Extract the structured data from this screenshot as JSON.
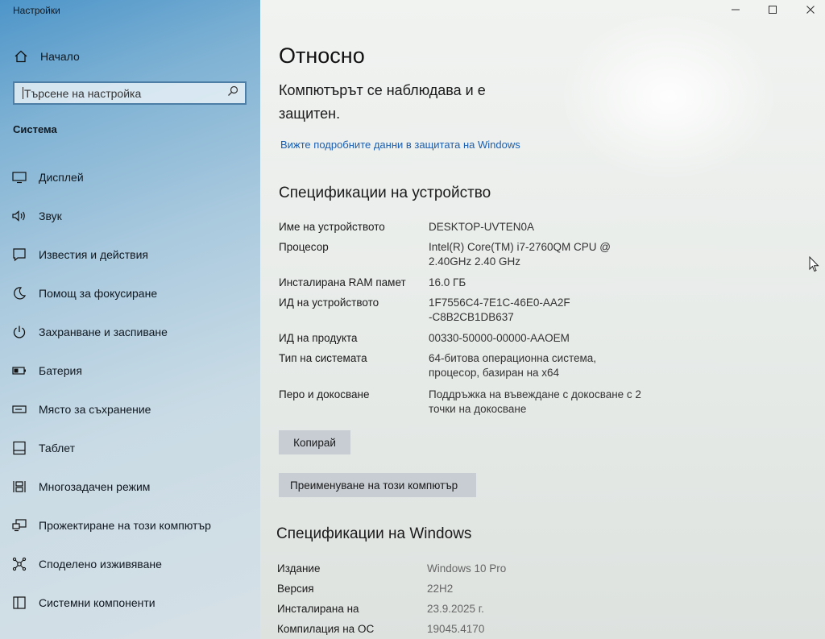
{
  "window": {
    "title": "Настройки",
    "controls": {
      "minimize": "—",
      "maximize": "☐",
      "close": "✕"
    }
  },
  "sidebar": {
    "home_label": "Начало",
    "search_placeholder": "Търсене на настройка",
    "section_title": "Система",
    "items": [
      {
        "label": "Дисплей",
        "icon": "display-icon"
      },
      {
        "label": "Звук",
        "icon": "sound-icon"
      },
      {
        "label": "Известия и действия",
        "icon": "notifications-icon"
      },
      {
        "label": "Помощ за фокусиране",
        "icon": "moon-icon"
      },
      {
        "label": "Захранване и заспиване",
        "icon": "power-icon"
      },
      {
        "label": "Батерия",
        "icon": "battery-icon"
      },
      {
        "label": "Място за съхранение",
        "icon": "storage-icon"
      },
      {
        "label": "Таблет",
        "icon": "tablet-icon"
      },
      {
        "label": "Многозадачен режим",
        "icon": "multitasking-icon"
      },
      {
        "label": "Прожектиране на този компютър",
        "icon": "projecting-icon"
      },
      {
        "label": "Споделено изживяване",
        "icon": "shared-icon"
      },
      {
        "label": "Системни компоненти",
        "icon": "components-icon"
      }
    ]
  },
  "main": {
    "title": "Относно",
    "protection_status": "Компютърът се наблюдава и е защитен.",
    "security_link": "Вижте подробните данни в защитата на Windows",
    "device_specs": {
      "heading": "Спецификации на устройство",
      "rows": [
        {
          "label": "Име на устройството",
          "value": "DESKTOP-UVTEN0A"
        },
        {
          "label": "Процесор",
          "value": "Intel(R) Core(TM) i7-2760QM CPU @ 2.40GHz   2.40 GHz"
        },
        {
          "label": "Инсталирана RAM памет",
          "value": "16.0 ГБ"
        },
        {
          "label": "ИД на устройството",
          "value": "1F7556C4-7E1C-46E0-AA2F-C8B2CB1DB637"
        },
        {
          "label": "ИД на продукта",
          "value": "00330-50000-00000-AAOEM"
        },
        {
          "label": "Тип на системата",
          "value": "64-битова операционна система, процесор, базиран на x64"
        },
        {
          "label": "Перо и докосване",
          "value": "Поддръжка на въвеждане с докосване с 2 точки на докосване"
        }
      ],
      "copy_button": "Копирай",
      "rename_button": "Преименуване на този компютър"
    },
    "windows_specs": {
      "heading": "Спецификации на Windows",
      "rows": [
        {
          "label": "Издание",
          "value": "Windows 10 Pro"
        },
        {
          "label": "Версия",
          "value": "22H2"
        },
        {
          "label": "Инсталирана на",
          "value": "23.9.2025 г."
        },
        {
          "label": "Компилация на ОС",
          "value": "19045.4170"
        }
      ]
    }
  },
  "colors": {
    "accent": "#1c5fb0",
    "button_bg": "#c7cdd3",
    "sidebar_top": "#4d95c9"
  }
}
